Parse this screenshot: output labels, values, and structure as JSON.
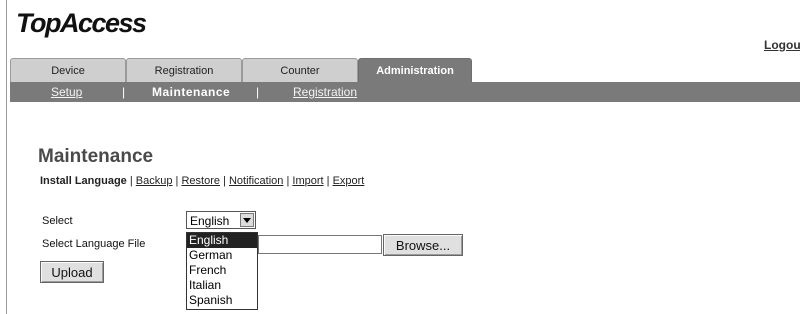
{
  "header": {
    "logo": "TopAccess",
    "logout": "Logou"
  },
  "tabs": [
    {
      "label": "Device"
    },
    {
      "label": "Registration"
    },
    {
      "label": "Counter"
    },
    {
      "label": "Administration",
      "active": true
    }
  ],
  "subnav": {
    "setup": "Setup",
    "maintenance": "Maintenance",
    "registration": "Registration",
    "separator": "|"
  },
  "page": {
    "title": "Maintenance",
    "subtabs": {
      "install_language": "Install Language",
      "backup": "Backup",
      "restore": "Restore",
      "notification": "Notification",
      "import": "Import",
      "export": "Export",
      "separator": "|"
    }
  },
  "form": {
    "select_label": "Select",
    "select_value": "English",
    "file_label": "Select Language File",
    "file_value": "",
    "browse_label": "Browse...",
    "upload_label": "Upload"
  },
  "dropdown": {
    "options": [
      "English",
      "German",
      "French",
      "Italian",
      "Spanish"
    ],
    "selected": "English"
  },
  "colors": {
    "active_tab": "#7a7a7a",
    "inactive_tab": "#cfcfcf",
    "subnav_bar": "#7a7a7a",
    "title_text": "#4a4a4a"
  }
}
